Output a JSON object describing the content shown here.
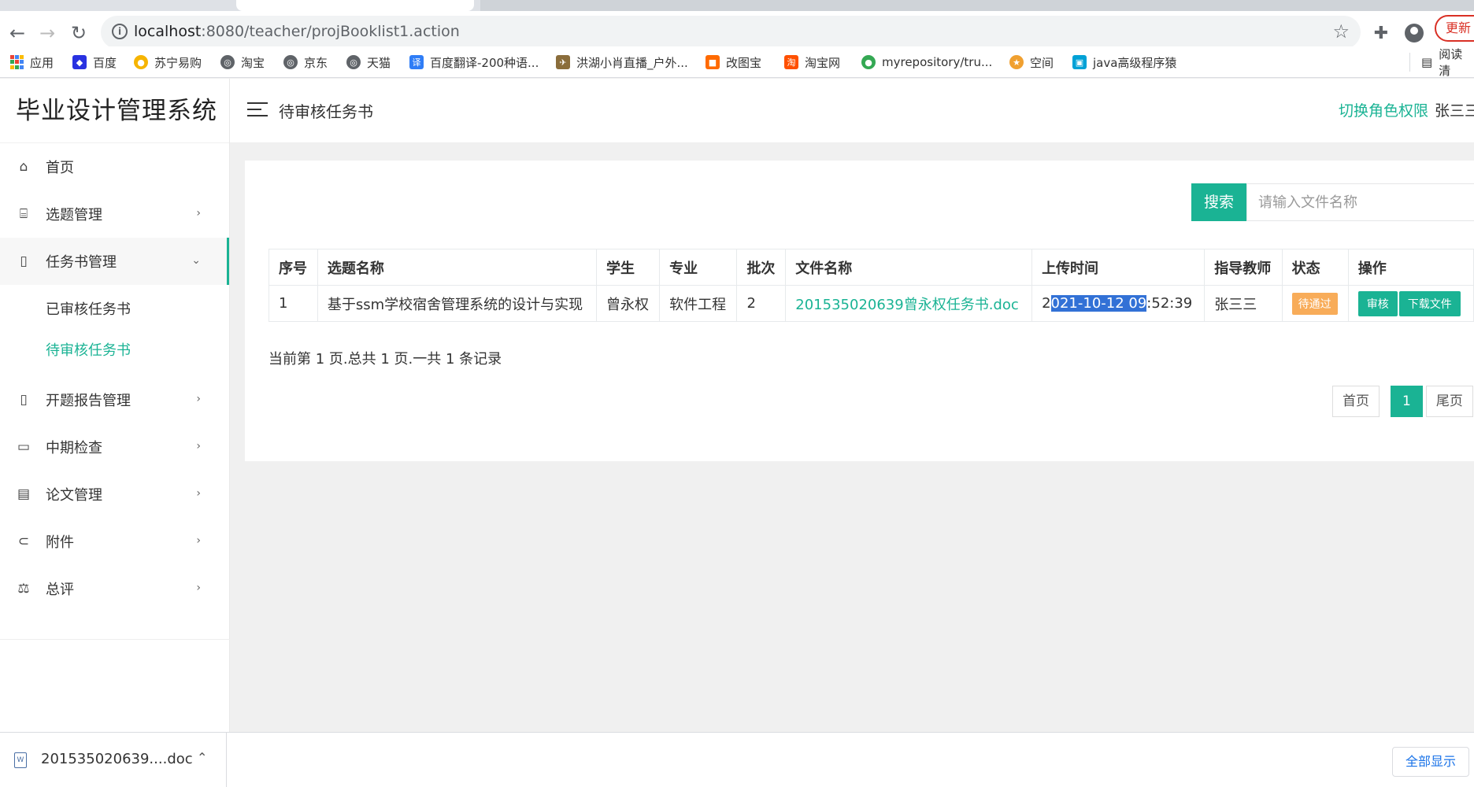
{
  "browser": {
    "url_host": "localhost",
    "url_rest": ":8080/teacher/projBooklist1.action",
    "update_label": "更新",
    "bookmarks": [
      "应用",
      "百度",
      "苏宁易购",
      "淘宝",
      "京东",
      "天猫",
      "百度翻译-200种语...",
      "洪湖小肖直播_户外...",
      "改图宝",
      "淘宝网",
      "myrepository/tru...",
      "空间",
      "java高级程序猿"
    ],
    "reader_label": "阅读清"
  },
  "sidebar": {
    "brand": "毕业设计管理系统",
    "items": [
      {
        "label": "首页",
        "icon": "home-icon"
      },
      {
        "label": "选题管理",
        "icon": "bank-icon"
      },
      {
        "label": "任务书管理",
        "icon": "file-icon"
      },
      {
        "label": "开题报告管理",
        "icon": "file-icon"
      },
      {
        "label": "中期检查",
        "icon": "book-icon"
      },
      {
        "label": "论文管理",
        "icon": "document-icon"
      },
      {
        "label": "附件",
        "icon": "paperclip-icon"
      },
      {
        "label": "总评",
        "icon": "balance-scale-icon"
      }
    ],
    "sub_items": [
      "已审核任务书",
      "待审核任务书"
    ]
  },
  "header": {
    "title": "待审核任务书",
    "switch_role": "切换角色权限",
    "user": "张三三"
  },
  "search": {
    "button": "搜索",
    "placeholder": "请输入文件名称"
  },
  "table": {
    "headers": [
      "序号",
      "选题名称",
      "学生",
      "专业",
      "批次",
      "文件名称",
      "上传时间",
      "指导教师",
      "状态",
      "操作"
    ],
    "rows": [
      {
        "index": "1",
        "topic": "基于ssm学校宿舍管理系统的设计与实现",
        "student": "曾永权",
        "major": "软件工程",
        "batch": "2",
        "file": "201535020639曾永权任务书.doc",
        "time_a": "2",
        "time_sel": "021-10-12 09",
        "time_b": ":52:39",
        "teacher": "张三三",
        "status": "待通过",
        "action_review": "审核",
        "action_download": "下载文件"
      }
    ]
  },
  "pagination": {
    "info": "当前第 1 页.总共 1 页.一共 1 条记录",
    "first": "首页",
    "current": "1",
    "last": "尾页"
  },
  "downloads": {
    "file": "201535020639....doc",
    "show_all": "全部显示"
  },
  "colors": {
    "accent": "#1ab394",
    "status_pending": "#f8ac59",
    "selection": "#3271d6"
  }
}
